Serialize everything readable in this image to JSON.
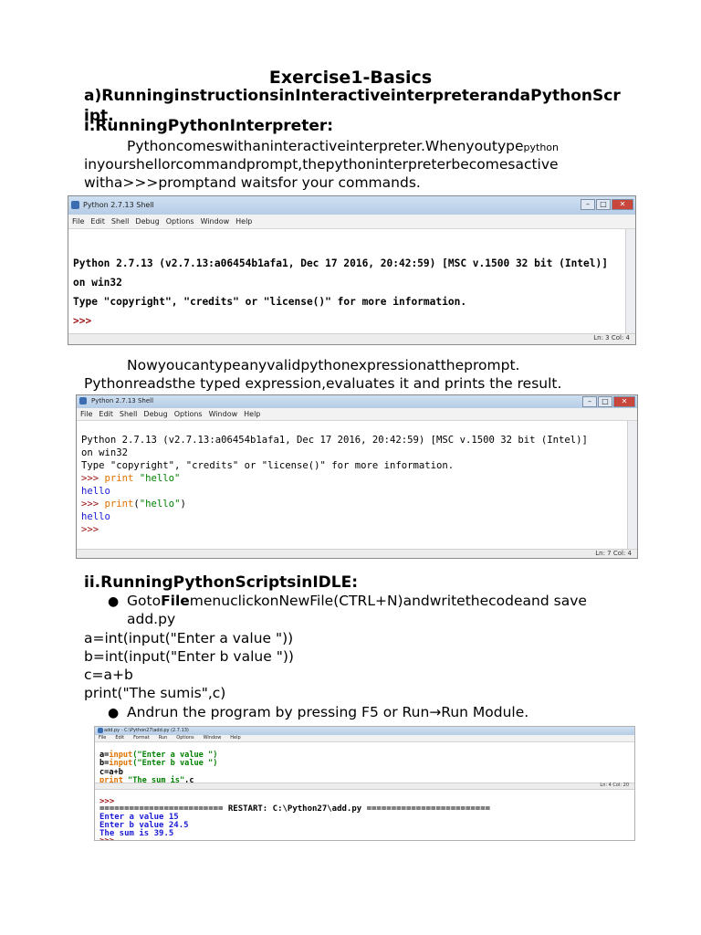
{
  "title": "Exercise1-Basics",
  "section_a": "a)RunninginstructionsinInteractiveinterpreterandaPythonScript.",
  "section_i": "i.RunningPythonInterpreter:",
  "para1": {
    "line1_main": "Pythoncomeswithaninteractiveinterpreter.Whenyoutype",
    "line1_small": "python",
    "line2": "inyourshellorcommandprompt,thepythoninterpreterbecomesactive",
    "line3": "witha>>>promptand waitsfor your commands."
  },
  "shell1": {
    "window_title": "Python 2.7.13 Shell",
    "menu": [
      "File",
      "Edit",
      "Shell",
      "Debug",
      "Options",
      "Window",
      "Help"
    ],
    "lines": [
      "Python 2.7.13 (v2.7.13:a06454b1afa1, Dec 17 2016, 20:42:59) [MSC v.1500 32 bit (Intel)]",
      "on win32",
      "Type \"copyright\", \"credits\" or \"license()\" for more information.",
      ">>>"
    ],
    "status": "Ln: 3  Col: 4"
  },
  "para2": {
    "line1": "Nowyoucantypeanyvalidpythonexpressionattheprompt.",
    "line2": "Pythonreadsthe typed expression,evaluates it and prints the result."
  },
  "shell2": {
    "window_title": "Python 2.7.13 Shell",
    "menu": [
      "File",
      "Edit",
      "Shell",
      "Debug",
      "Options",
      "Window",
      "Help"
    ],
    "lines": [
      "Python 2.7.13 (v2.7.13:a06454b1afa1, Dec 17 2016, 20:42:59) [MSC v.1500 32 bit (Intel)]",
      "on win32",
      "Type \"copyright\", \"credits\" or \"license()\" for more information."
    ],
    "prompt": ">>> ",
    "print_kw": "print",
    "str1": " \"hello\"",
    "out1": "hello",
    "str2_open": "(",
    "str2": "\"hello\"",
    "str2_close": ")",
    "out2": "hello",
    "last_prompt": ">>>",
    "status": "Ln: 7  Col: 4"
  },
  "section_ii": "ii.RunningPythonScriptsinIDLE:",
  "bullet1": {
    "pre": "Goto",
    "bold": "File",
    "post": "menuclickonNewFile(CTRL+N)andwritethecodeand save",
    "line2": "add.py"
  },
  "code_lines": [
    "a=int(input(\"Enter a value \"))",
    "b=int(input(\"Enter b value \"))",
    "c=a+b",
    "print(\"The sumis\",c)"
  ],
  "bullet2": "Andrun the program by pressing F5 or Run→Run Module.",
  "editor": {
    "window_title": "add.py - C:\\Python27\\add.py (2.7.13)",
    "menu": [
      "File",
      "Edit",
      "Format",
      "Run",
      "Options",
      "Window",
      "Help"
    ],
    "l1_a": "a=",
    "l1_kw": "input",
    "l1_s": "(\"Enter a value \")",
    "l2_a": "b=",
    "l2_kw": "input",
    "l2_s": "(\"Enter b value \")",
    "l3": "c=a+b",
    "l4_kw": "print",
    "l4_s": " \"The sum is\"",
    "l4_e": ",c",
    "status": "Ln: 4  Col: 20"
  },
  "run_output": {
    "prompt_top": ">>>",
    "restart": "========================= RESTART: C:\\Python27\\add.py =========================",
    "out_lines": [
      "Enter a value 15",
      "Enter b value 24.5",
      "The sum is 39.5"
    ],
    "prompt_end": ">>>"
  }
}
